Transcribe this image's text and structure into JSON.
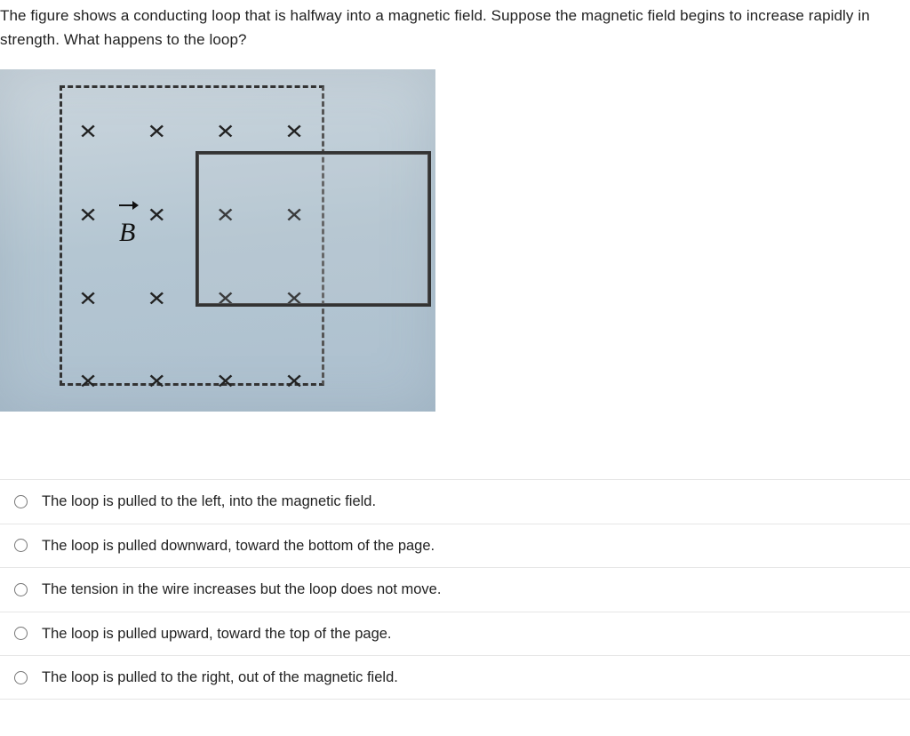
{
  "question": "The figure shows a conducting loop that is halfway into a magnetic field. Suppose the magnetic field begins to increase rapidly in strength. What happens to the loop?",
  "field_symbol_label": "B",
  "x_mark": "✕",
  "answers": [
    "The loop is pulled to the left, into the magnetic field.",
    "The loop is pulled downward, toward the bottom of the page.",
    "The tension in the wire increases but the loop does not move.",
    "The loop is pulled upward, toward the top of the page.",
    "The loop is pulled to the right, out of the magnetic field."
  ]
}
